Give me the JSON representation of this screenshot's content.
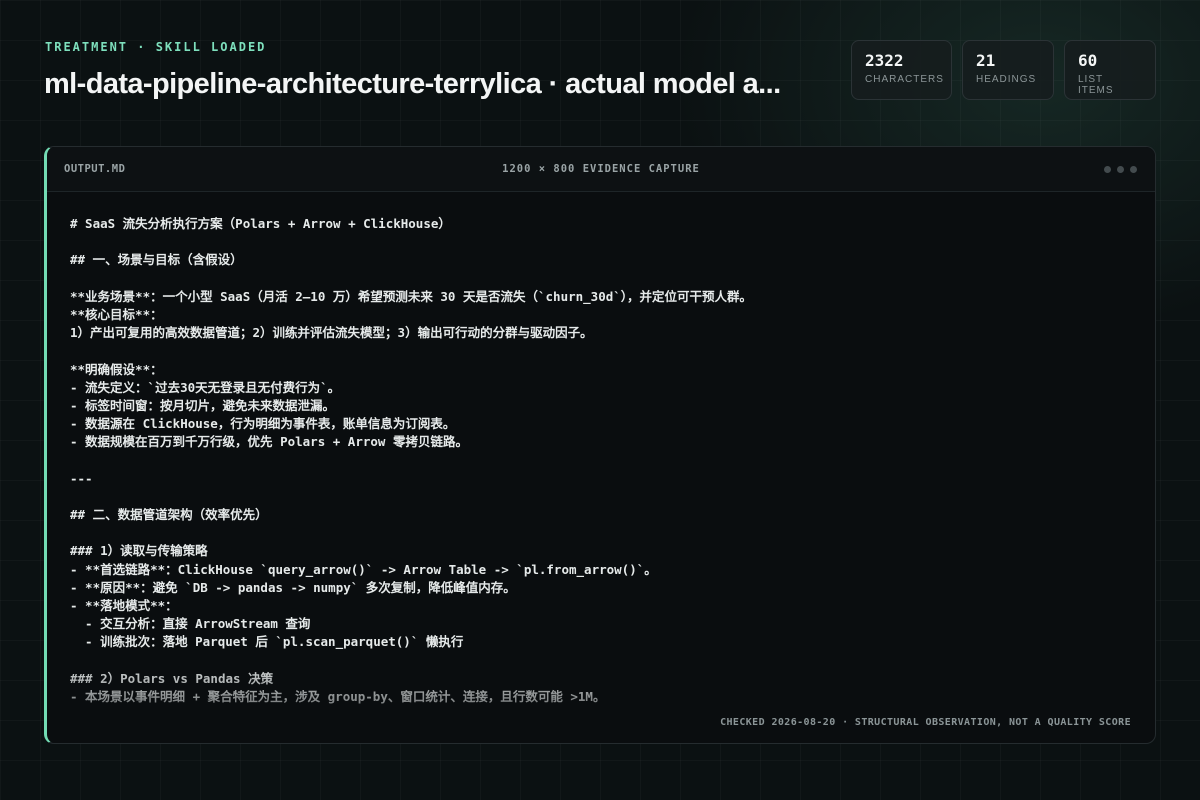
{
  "header": {
    "eyebrow": "TREATMENT · SKILL LOADED",
    "title": "ml-data-pipeline-architecture-terrylica · actual model a..."
  },
  "stats": [
    {
      "value": "2322",
      "label": "Characters"
    },
    {
      "value": "21",
      "label": "Headings"
    },
    {
      "value": "60",
      "label": "List items"
    }
  ],
  "panel": {
    "filename": "OUTPUT.MD",
    "capture_label": "1200 × 800 EVIDENCE CAPTURE",
    "footer": "CHECKED 2026-08-20 · STRUCTURAL OBSERVATION, NOT A QUALITY SCORE",
    "lines": [
      "# SaaS 流失分析执行方案（Polars + Arrow + ClickHouse）",
      "",
      "## 一、场景与目标（含假设）",
      "",
      "**业务场景**：一个小型 SaaS（月活 2–10 万）希望预测未来 30 天是否流失（`churn_30d`），并定位可干预人群。",
      "**核心目标**：",
      "1）产出可复用的高效数据管道；2）训练并评估流失模型；3）输出可行动的分群与驱动因子。",
      "",
      "**明确假设**：",
      "- 流失定义：`过去30天无登录且无付费行为`。",
      "- 标签时间窗：按月切片，避免未来数据泄漏。",
      "- 数据源在 ClickHouse，行为明细为事件表，账单信息为订阅表。",
      "- 数据规模在百万到千万行级，优先 Polars + Arrow 零拷贝链路。",
      "",
      "---",
      "",
      "## 二、数据管道架构（效率优先）",
      "",
      "### 1）读取与传输策略",
      "- **首选链路**：ClickHouse `query_arrow()` -> Arrow Table -> `pl.from_arrow()`。",
      "- **原因**：避免 `DB -> pandas -> numpy` 多次复制，降低峰值内存。",
      "- **落地模式**：",
      "  - 交互分析：直接 ArrowStream 查询",
      "  - 训练批次：落地 Parquet 后 `pl.scan_parquet()` 懒执行",
      "",
      "### 2）Polars vs Pandas 决策",
      "- 本场景以事件明细 + 聚合特征为主，涉及 group-by、窗口统计、连接，且行数可能 >1M。"
    ]
  }
}
